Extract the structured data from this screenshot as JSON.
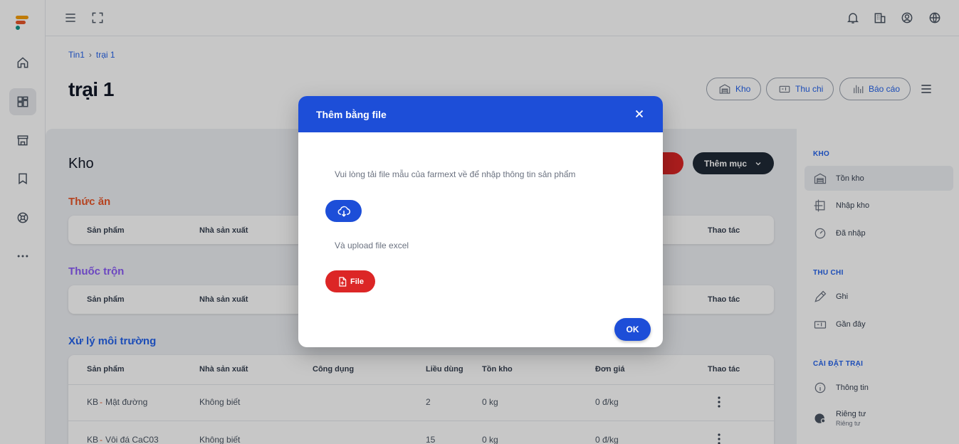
{
  "breadcrumb": {
    "root": "Tin1",
    "current": "trại 1"
  },
  "page": {
    "title": "trại 1"
  },
  "header_actions": {
    "kho": "Kho",
    "thu_chi": "Thu chi",
    "bao_cao": "Báo cáo"
  },
  "toolbar": {
    "add_label": "Thêm mục"
  },
  "main": {
    "title": "Kho",
    "sections": [
      {
        "title": "Thức ăn",
        "color": "#e8562a"
      },
      {
        "title": "Thuốc trộn",
        "color": "#8b5cf6"
      },
      {
        "title": "Xử lý môi trường",
        "color": "#2563eb"
      }
    ],
    "columns": {
      "san_pham": "Sản phẩm",
      "nha_san_xuat": "Nhà sản xuất",
      "cong_dung": "Công dụng",
      "lieu_dung": "Liều dùng",
      "ton_kho": "Tồn kho",
      "don_gia": "Đơn giá",
      "thao_tac": "Thao tác"
    },
    "rows": [
      {
        "code": "KB",
        "dash": "-",
        "name": "Mật đường",
        "maker": "Không biết",
        "dose": "2",
        "stock": "0 kg",
        "price": "0 đ/kg"
      },
      {
        "code": "KB",
        "dash": "-",
        "name": "Vôi đá CaC03",
        "maker": "Không biết",
        "dose": "15",
        "stock": "0 kg",
        "price": "0 đ/kg"
      }
    ]
  },
  "sidebar": {
    "kho_heading": "KHO",
    "kho_items": [
      {
        "label": "Tồn kho"
      },
      {
        "label": "Nhập kho"
      },
      {
        "label": "Đã nhập"
      }
    ],
    "thu_chi_heading": "THU CHI",
    "thu_chi_items": [
      {
        "label": "Ghi"
      },
      {
        "label": "Gần đây"
      }
    ],
    "cai_dat_heading": "CÀI ĐẶT TRẠI",
    "cai_dat_items": [
      {
        "label": "Thông tin"
      },
      {
        "label": "Riêng tư",
        "sub": "Riêng tư"
      }
    ]
  },
  "modal": {
    "title": "Thêm bằng file",
    "instruction": "Vui lòng tải file mẫu của farmext về để nhập thông tin sản phẩm",
    "upload_text": "Và upload file excel",
    "file_button": "File",
    "ok_button": "OK"
  },
  "colors": {
    "primary": "#1d4ed8",
    "danger": "#dc2626",
    "dark": "#1f2937"
  }
}
